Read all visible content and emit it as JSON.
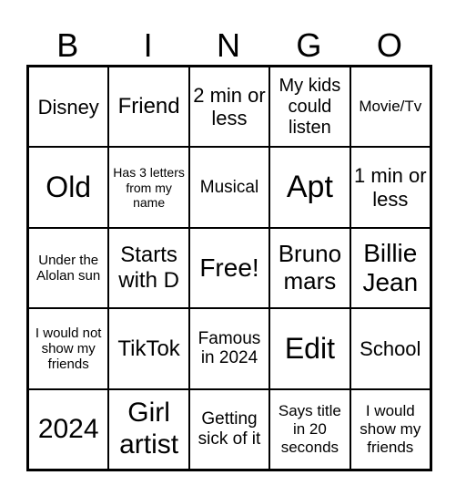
{
  "header": {
    "letters": [
      "B",
      "I",
      "N",
      "G",
      "O"
    ]
  },
  "cells": [
    "Disney",
    "Friend",
    "2 min or less",
    "My kids could listen",
    "Movie/Tv",
    "Old",
    "Has 3 letters from my name",
    "Musical",
    "Apt",
    "1 min or less",
    "Under the Alolan sun",
    "Starts with D",
    "Free!",
    "Bruno mars",
    "Billie Jean",
    "I would not show my friends",
    "TikTok",
    "Famous in 2024",
    "Edit",
    "School",
    "2024",
    "Girl artist",
    "Getting sick of it",
    "Says title in 20 seconds",
    "I would show my friends"
  ]
}
